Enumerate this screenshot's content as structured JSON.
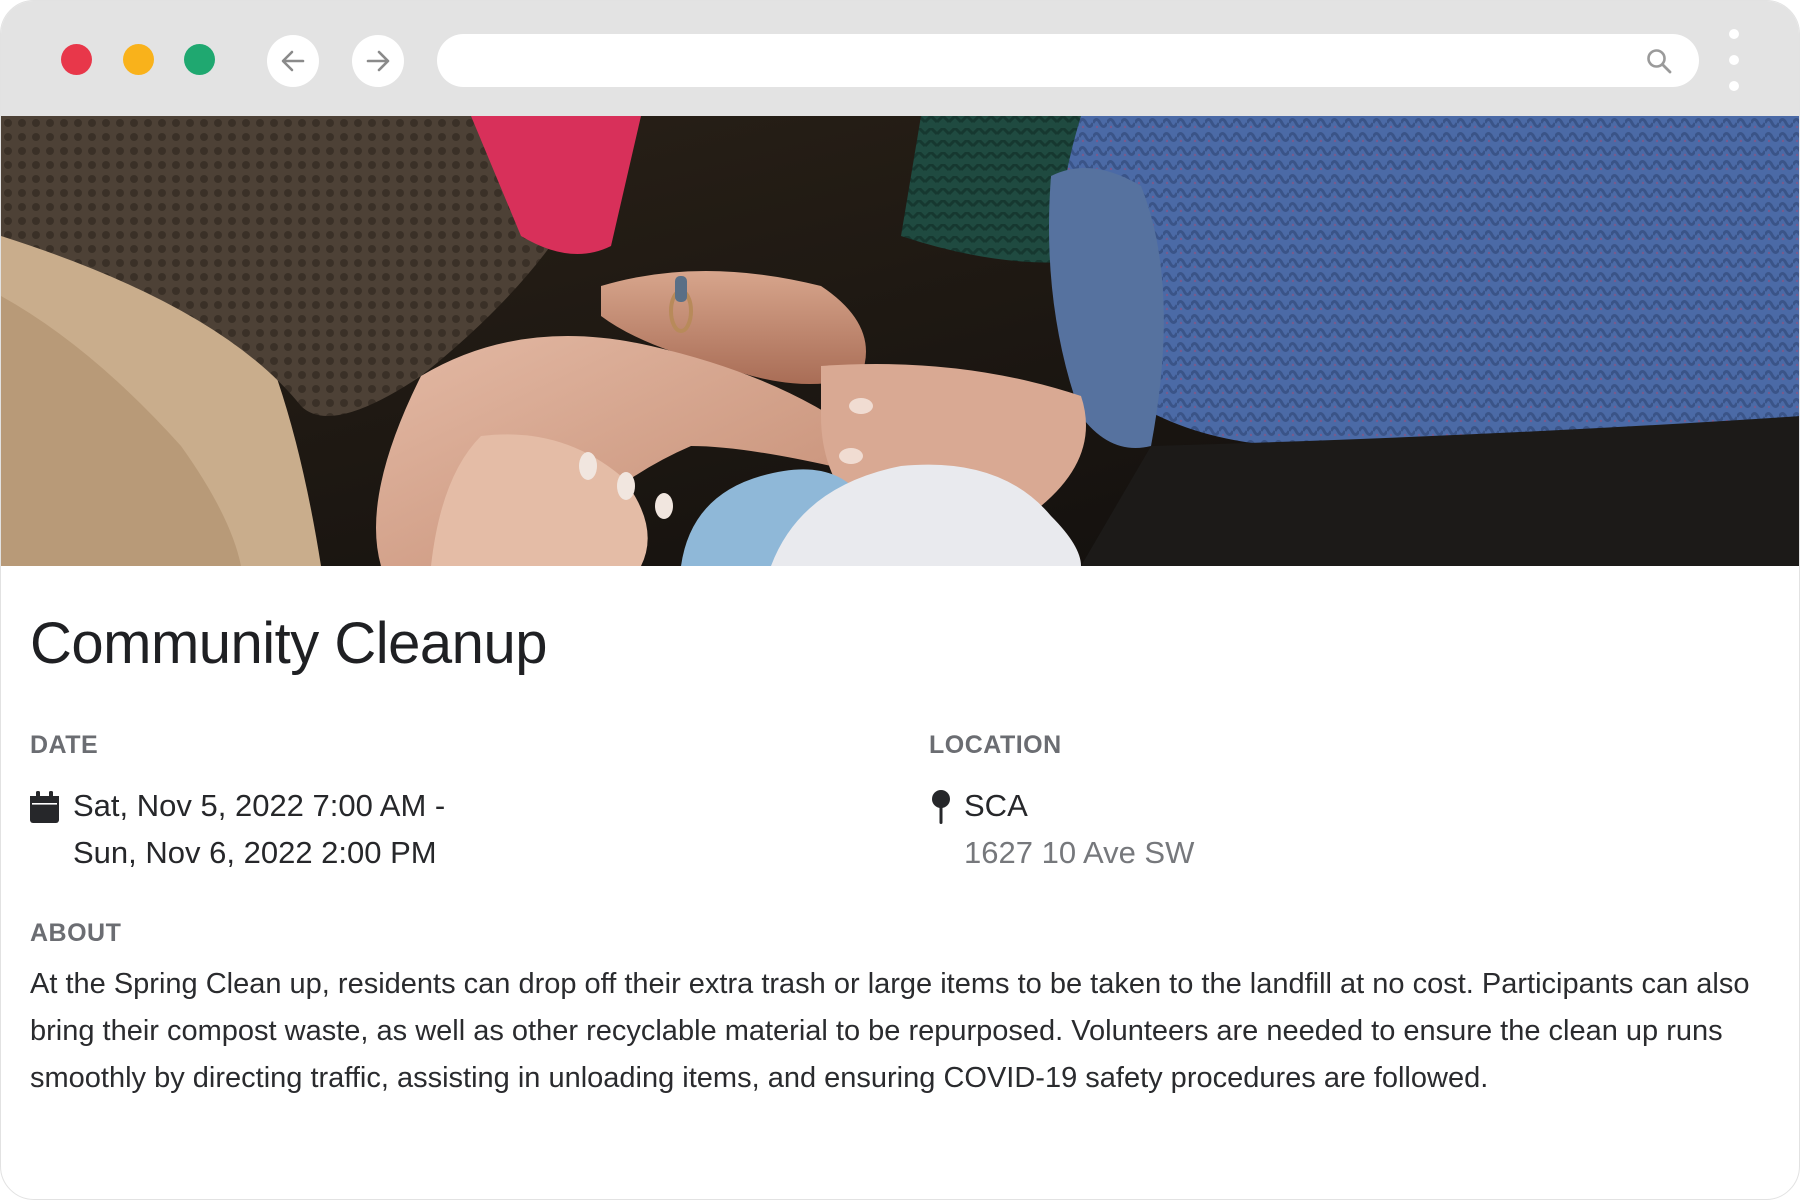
{
  "browser": {
    "traffic_lights": {
      "close_color": "#e8374a",
      "minimize_color": "#f9b21b",
      "maximize_color": "#1fa870"
    },
    "address_value": "",
    "back_icon": "arrow-left-icon",
    "forward_icon": "arrow-right-icon",
    "search_icon": "search-icon",
    "menu_icon": "more-vertical-icon"
  },
  "event": {
    "hero_image": "hands-stacked-together-photo",
    "title": "Community Cleanup",
    "date": {
      "label": "DATE",
      "icon": "calendar-icon",
      "start": "Sat, Nov 5, 2022 7:00 AM -",
      "end": "Sun, Nov 6, 2022 2:00 PM"
    },
    "location": {
      "label": "LOCATION",
      "icon": "map-pin-icon",
      "name": "SCA",
      "address": "1627 10 Ave SW"
    },
    "about": {
      "label": "ABOUT",
      "text": "At the Spring Clean up, residents can drop off their extra trash or large items to be taken to the landfill at no cost. Participants can also bring their compost waste, as well as other recyclable material to be repurposed. Volunteers are needed to ensure the clean up runs smoothly by directing traffic, assisting in unloading items, and ensuring COVID-19 safety procedures are followed."
    }
  }
}
